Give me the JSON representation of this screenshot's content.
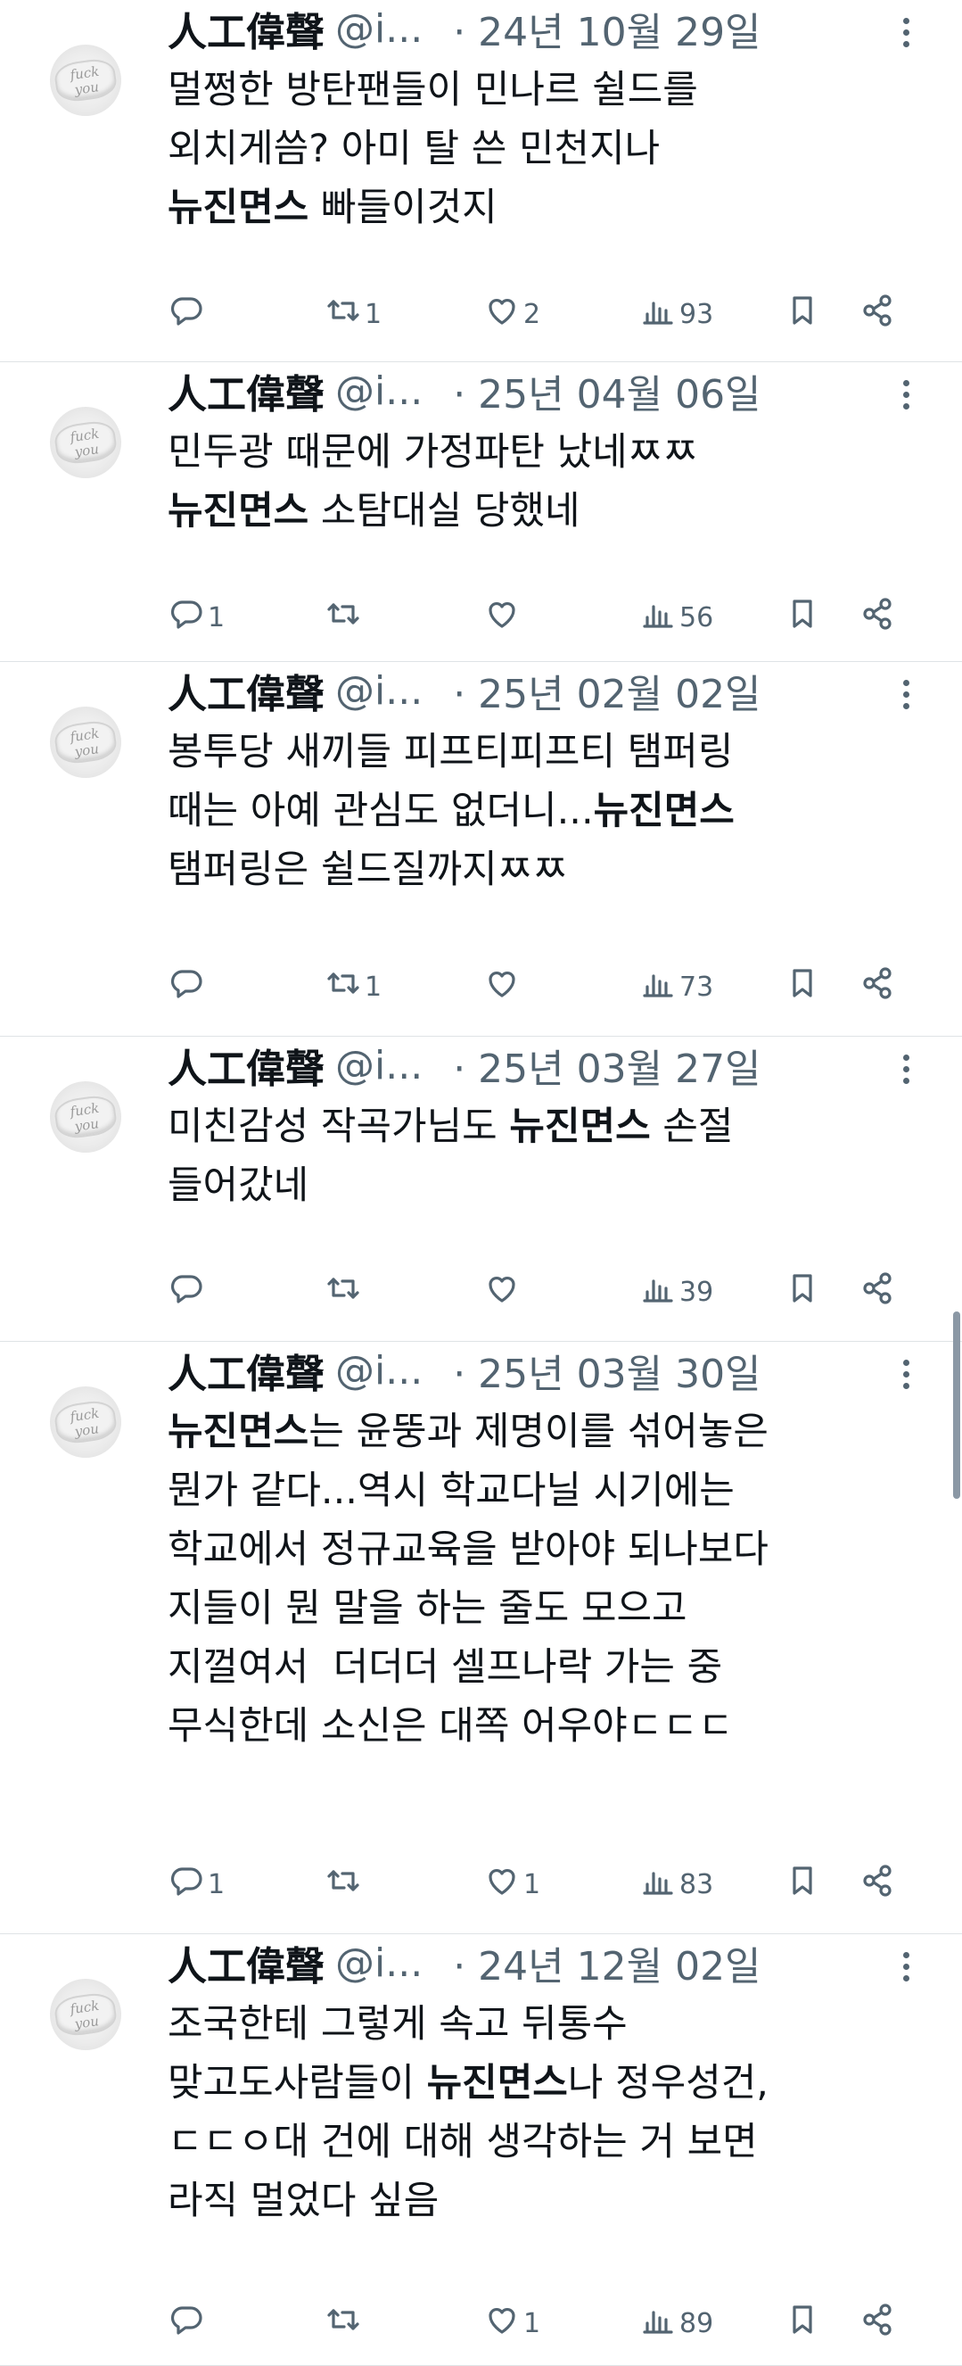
{
  "tweets": [
    {
      "name": "人工偉聲",
      "handle": "@i...",
      "date": "· 24년 10월 29일",
      "segments": [
        {
          "t": "멀쩡한 방탄팬들이 민나르 쉴드를\n외치게씀? 아미 탈 쓴 민천지나\n",
          "b": false
        },
        {
          "t": "뉴진면스",
          "b": true
        },
        {
          "t": " 빠들이것지",
          "b": false
        }
      ],
      "replies": "",
      "retweets": "1",
      "likes": "2",
      "views": "93"
    },
    {
      "name": "人工偉聲",
      "handle": "@i...",
      "date": "· 25년 04월 06일",
      "segments": [
        {
          "t": "민두광 때문에 가정파탄 났네ㅉㅉ\n",
          "b": false
        },
        {
          "t": "뉴진면스",
          "b": true
        },
        {
          "t": " 소탐대실 당했네",
          "b": false
        }
      ],
      "replies": "1",
      "retweets": "",
      "likes": "",
      "views": "56"
    },
    {
      "name": "人工偉聲",
      "handle": "@i...",
      "date": "· 25년 02월 02일",
      "segments": [
        {
          "t": "봉투당 새끼들 피프티피프티 탬퍼링\n때는 아예 관심도 없더니...",
          "b": false
        },
        {
          "t": "뉴진면스",
          "b": true
        },
        {
          "t": "\n탬퍼링은 쉴드질까지ㅉㅉ",
          "b": false
        }
      ],
      "replies": "",
      "retweets": "1",
      "likes": "",
      "views": "73"
    },
    {
      "name": "人工偉聲",
      "handle": "@i...",
      "date": "· 25년 03월 27일",
      "segments": [
        {
          "t": "미친감성 작곡가님도 ",
          "b": false
        },
        {
          "t": "뉴진면스",
          "b": true
        },
        {
          "t": " 손절\n들어갔네",
          "b": false
        }
      ],
      "replies": "",
      "retweets": "",
      "likes": "",
      "views": "39"
    },
    {
      "name": "人工偉聲",
      "handle": "@i...",
      "date": "· 25년 03월 30일",
      "segments": [
        {
          "t": "뉴진면스",
          "b": true
        },
        {
          "t": "는 윤뚱과 제명이를 섞어놓은\n뭔가 같다...역시 학교다닐 시기에는\n학교에서 정규교육을 받아야 되나보다\n지들이 뭔 말을 하는 줄도 모으고\n지껄여서  더더더 셀프나락 가는 중\n무식한데 소신은 대쪽 어우야ㄷㄷㄷ",
          "b": false
        }
      ],
      "replies": "1",
      "retweets": "",
      "likes": "1",
      "views": "83"
    },
    {
      "name": "人工偉聲",
      "handle": "@i...",
      "date": "· 24년 12월 02일",
      "segments": [
        {
          "t": "조국한테 그렇게 속고 뒤통수\n맞고도사람들이 ",
          "b": false
        },
        {
          "t": "뉴진면스",
          "b": true
        },
        {
          "t": "나 정우성건,\nㄷㄷㅇ대 건에 대해 생각하는 거 보면\n라직 멀었다 싶음",
          "b": false
        }
      ],
      "replies": "",
      "retweets": "",
      "likes": "1",
      "views": "89"
    }
  ],
  "avatar_text": "fuck you",
  "icons": {
    "reply": "reply-icon",
    "retweet": "retweet-icon",
    "like": "like-icon",
    "views": "views-icon",
    "bookmark": "bookmark-icon",
    "share": "share-icon",
    "more": "more-icon"
  },
  "colors": {
    "text": "#0f1419",
    "secondary": "#536471",
    "divider": "#dfe3e6"
  }
}
